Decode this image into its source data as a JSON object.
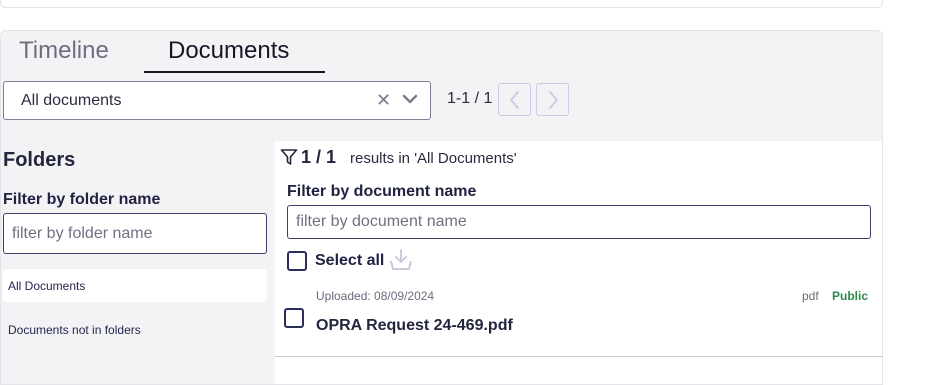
{
  "tabs": [
    {
      "label": "Timeline",
      "active": false
    },
    {
      "label": "Documents",
      "active": true
    }
  ],
  "document_select": {
    "value": "All documents"
  },
  "pager": {
    "text": "1-1 / 1"
  },
  "folders": {
    "title": "Folders",
    "filter_label": "Filter by folder name",
    "filter_placeholder": "filter by folder name",
    "items": [
      {
        "label": "All Documents",
        "selected": true
      },
      {
        "label": "Documents not in folders",
        "selected": false
      }
    ]
  },
  "results": {
    "count": "1 / 1",
    "summary": "results in 'All Documents'",
    "filter_label": "Filter by document name",
    "filter_placeholder": "filter by document name",
    "select_all_label": "Select all",
    "documents": [
      {
        "uploaded": "Uploaded: 08/09/2024",
        "extension": "pdf",
        "visibility": "Public",
        "name": "OPRA Request 24-469.pdf"
      }
    ]
  },
  "colors": {
    "accent": "#2b2e5a",
    "public": "#2f8a4c",
    "pager_border": "#c9cbe8"
  },
  "icons": [
    "clear-icon",
    "chevron-down-icon",
    "chevron-left-icon",
    "chevron-right-icon",
    "filter-icon",
    "download-icon"
  ]
}
